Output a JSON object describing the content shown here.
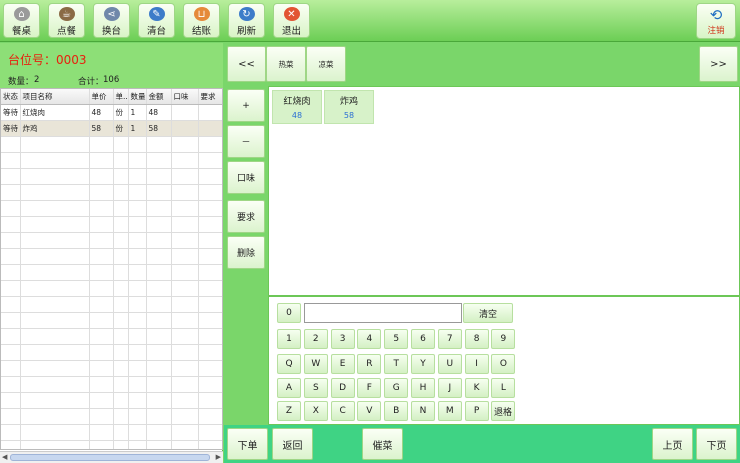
{
  "toolbar": {
    "buttons": [
      {
        "label": "餐桌",
        "icon": "home-icon",
        "color": "#8a8a8a"
      },
      {
        "label": "点餐",
        "icon": "teacup-icon",
        "color": "#7a5b3a"
      },
      {
        "label": "换台",
        "icon": "share-icon",
        "color": "#6a7fa0"
      },
      {
        "label": "清台",
        "icon": "broom-icon",
        "color": "#3d7cc9"
      },
      {
        "label": "结账",
        "icon": "cart-icon",
        "color": "#e07a2c"
      },
      {
        "label": "刷新",
        "icon": "refresh-icon",
        "color": "#3d7cc9"
      },
      {
        "label": "退出",
        "icon": "close-icon",
        "color": "#e04a2c"
      }
    ],
    "logout_label": "注销"
  },
  "order": {
    "table_label": "台位号：0003",
    "quantity_label": "数量：",
    "quantity": "2",
    "total_label": "合计：",
    "total": "106",
    "columns": [
      "状态",
      "项目名称",
      "单价",
      "单..",
      "数量",
      "金额",
      "口味",
      "要求"
    ],
    "rows": [
      [
        "等待",
        "红烧肉",
        "48",
        "份",
        "1",
        "48",
        "",
        ""
      ],
      [
        "等待",
        "炸鸡",
        "58",
        "份",
        "1",
        "58",
        "",
        ""
      ]
    ]
  },
  "categories": {
    "prev": "<<",
    "next": ">>",
    "items": [
      "热菜",
      "凉菜"
    ]
  },
  "actions": [
    "+",
    "－",
    "口味",
    "要求",
    "删除"
  ],
  "dishes": [
    {
      "name": "红烧肉",
      "price": "48"
    },
    {
      "name": "炸鸡",
      "price": "58"
    }
  ],
  "keyboard": {
    "zero": "0",
    "input_value": "",
    "clear": "清空",
    "row1": [
      "1",
      "2",
      "3",
      "4",
      "5",
      "6",
      "7",
      "8",
      "9"
    ],
    "row2": [
      "Q",
      "W",
      "E",
      "R",
      "T",
      "Y",
      "U",
      "I",
      "O"
    ],
    "row3": [
      "A",
      "S",
      "D",
      "F",
      "G",
      "H",
      "J",
      "K",
      "L"
    ],
    "row4": [
      "Z",
      "X",
      "C",
      "V",
      "B",
      "N",
      "M",
      "P"
    ],
    "backspace": "退格"
  },
  "bottom": {
    "submit": "下单",
    "back": "返回",
    "urge": "催菜",
    "prev_page": "上页",
    "next_page": "下页"
  }
}
